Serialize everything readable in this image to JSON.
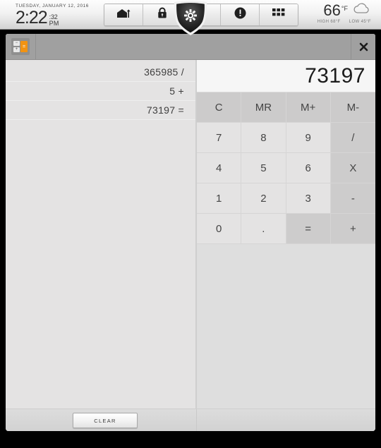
{
  "statusbar": {
    "date": "TUESDAY, JANUARY 12, 2016",
    "time": "2:22",
    "seconds": ":32",
    "ampm": "PM",
    "nav_buttons": [
      {
        "name": "garage-door-icon",
        "label": "Garage"
      },
      {
        "name": "lock-icon",
        "label": "Lock"
      },
      {
        "name": "settings-gear-icon",
        "label": "Settings"
      },
      {
        "name": "alert-icon",
        "label": "Alerts"
      },
      {
        "name": "apps-grid-icon",
        "label": "Apps"
      }
    ],
    "weather": {
      "temp": "66",
      "unit": "°F",
      "high": "HIGH 68°F",
      "low": "LOW 45°F",
      "condition_icon": "cloud-icon"
    }
  },
  "window": {
    "app_icon": "calculator-icon",
    "app_icon_keys": [
      "−",
      "+"
    ],
    "app_icon_equals": "=",
    "close_label": "✕"
  },
  "history": {
    "rows": [
      "365985 /",
      "5 +",
      "73197 ="
    ]
  },
  "calculator": {
    "display": "73197",
    "keys": [
      {
        "label": "C",
        "kind": "mem",
        "name": "key-clear"
      },
      {
        "label": "MR",
        "kind": "mem",
        "name": "key-memory-recall"
      },
      {
        "label": "M+",
        "kind": "mem",
        "name": "key-memory-add"
      },
      {
        "label": "M-",
        "kind": "mem",
        "name": "key-memory-subtract"
      },
      {
        "label": "7",
        "kind": "num",
        "name": "key-7"
      },
      {
        "label": "8",
        "kind": "num",
        "name": "key-8"
      },
      {
        "label": "9",
        "kind": "num",
        "name": "key-9"
      },
      {
        "label": "/",
        "kind": "op",
        "name": "key-divide"
      },
      {
        "label": "4",
        "kind": "num",
        "name": "key-4"
      },
      {
        "label": "5",
        "kind": "num",
        "name": "key-5"
      },
      {
        "label": "6",
        "kind": "num",
        "name": "key-6"
      },
      {
        "label": "X",
        "kind": "op",
        "name": "key-multiply"
      },
      {
        "label": "1",
        "kind": "num",
        "name": "key-1"
      },
      {
        "label": "2",
        "kind": "num",
        "name": "key-2"
      },
      {
        "label": "3",
        "kind": "num",
        "name": "key-3"
      },
      {
        "label": "-",
        "kind": "op",
        "name": "key-subtract"
      },
      {
        "label": "0",
        "kind": "num",
        "name": "key-0"
      },
      {
        "label": ".",
        "kind": "num",
        "name": "key-decimal"
      },
      {
        "label": "=",
        "kind": "eq",
        "name": "key-equals"
      },
      {
        "label": "+",
        "kind": "op",
        "name": "key-add"
      }
    ]
  },
  "footer": {
    "clear_label": "CLEAR"
  },
  "colors": {
    "accent_orange": "#f29312",
    "titlebar_gray": "#a0a0a0",
    "panel_gray": "#e4e3e3",
    "key_op_gray": "#cdcccc"
  }
}
